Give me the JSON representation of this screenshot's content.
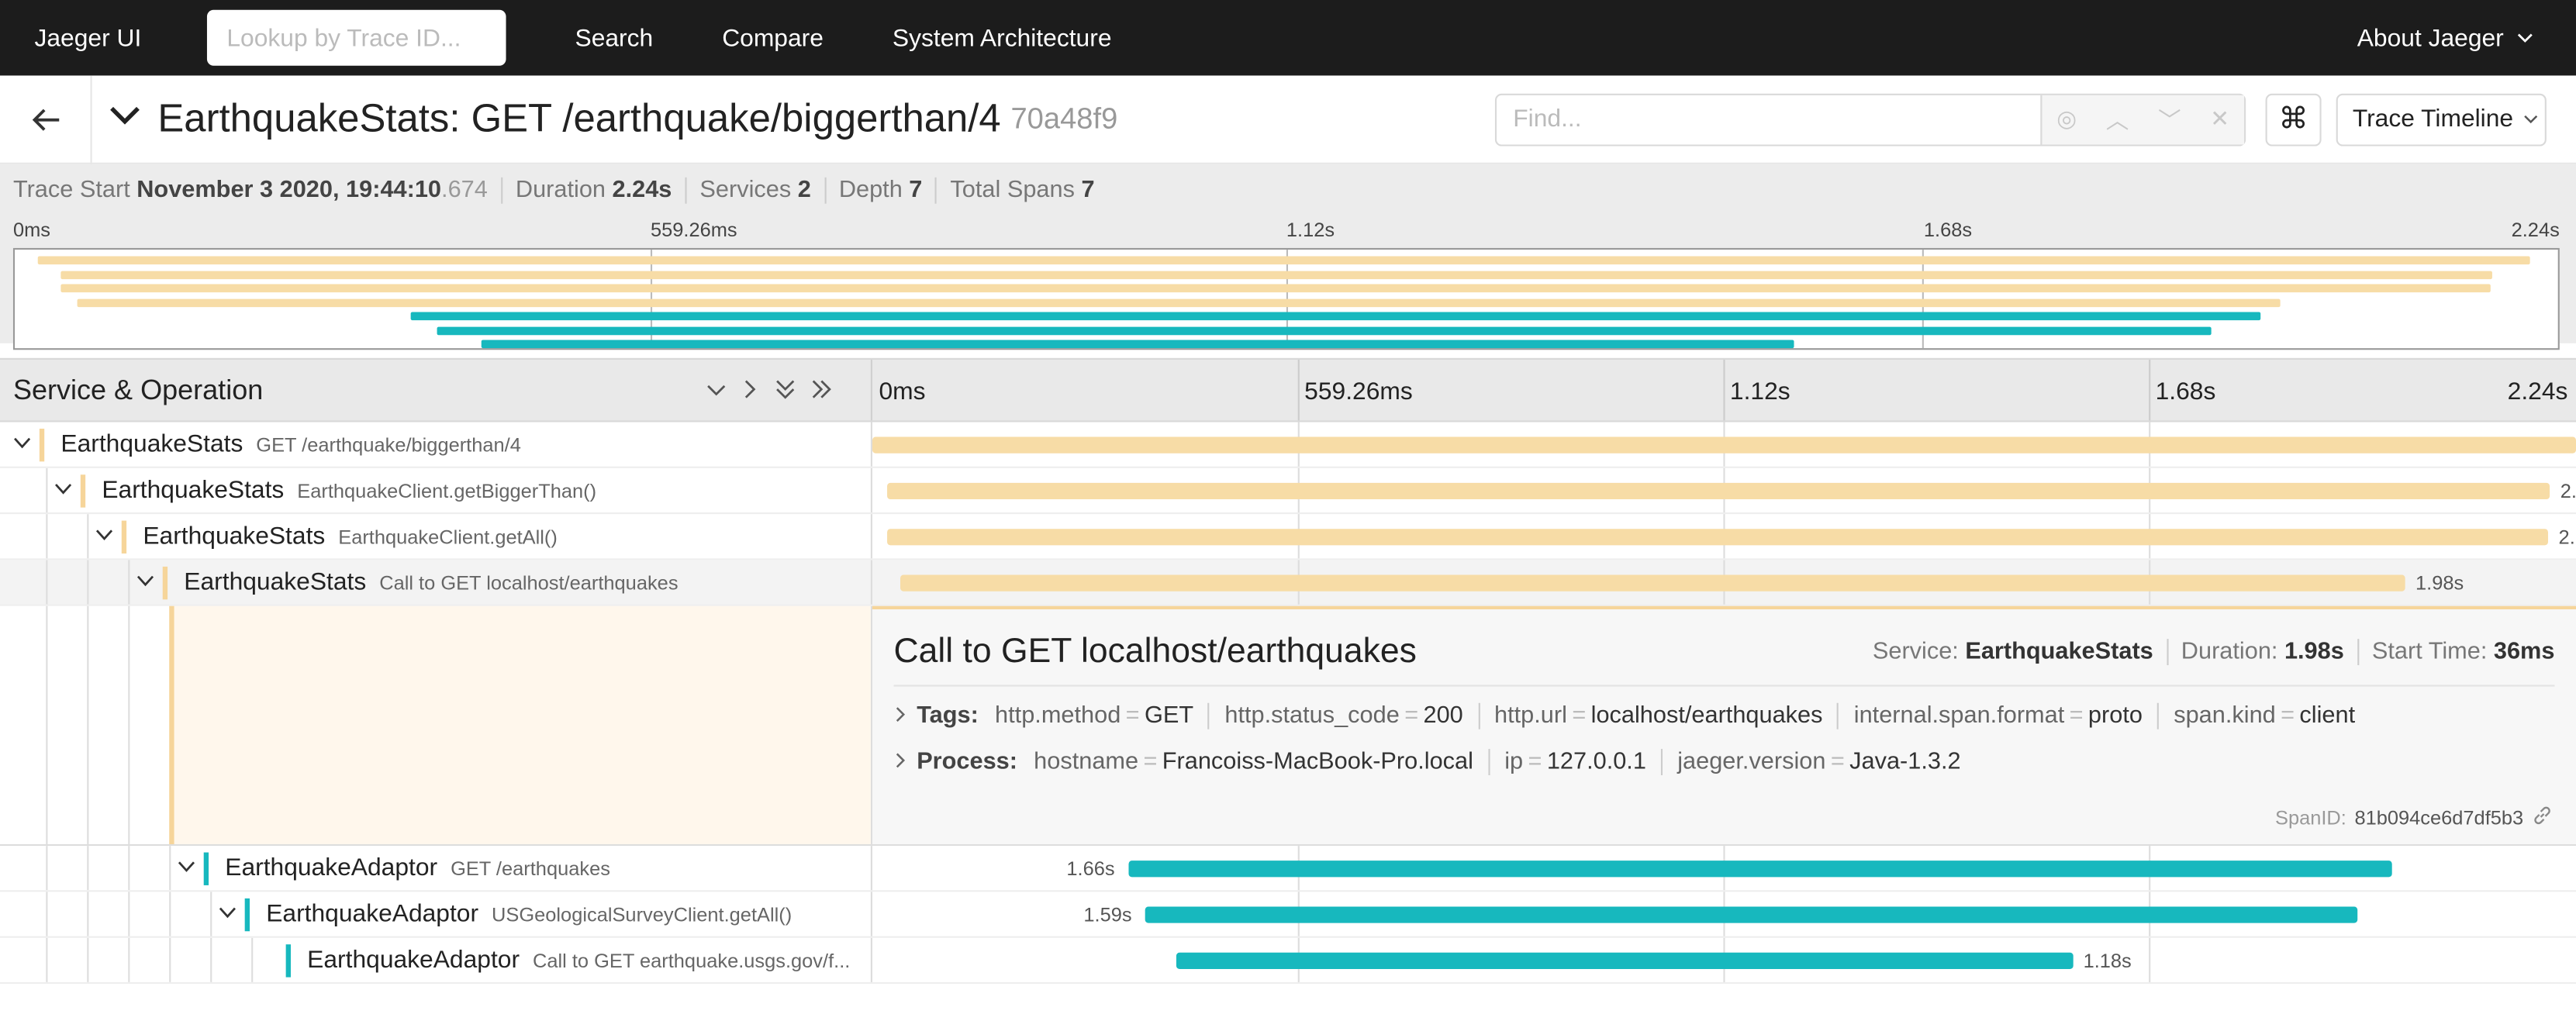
{
  "nav": {
    "brand": "Jaeger UI",
    "lookup_placeholder": "Lookup by Trace ID...",
    "links": [
      "Search",
      "Compare",
      "System Architecture"
    ],
    "about": "About Jaeger"
  },
  "trace": {
    "title": "EarthquakeStats: GET /earthquake/biggerthan/4",
    "trace_id": "70a48f9",
    "find_placeholder": "Find...",
    "view_mode": "Trace Timeline"
  },
  "summary": {
    "start_label": "Trace Start",
    "start_value": "November 3 2020, 19:44:10",
    "start_ms": ".674",
    "duration_label": "Duration",
    "duration_value": "2.24s",
    "services_label": "Services",
    "services_value": "2",
    "depth_label": "Depth",
    "depth_value": "7",
    "spans_label": "Total Spans",
    "spans_value": "7"
  },
  "ticks": [
    "0ms",
    "559.26ms",
    "1.12s",
    "1.68s",
    "2.24s"
  ],
  "colors": {
    "stats": "#f7dca6",
    "stats_mark": "#f6d59a",
    "adaptor": "#17b8be"
  },
  "header": {
    "service_operation": "Service & Operation"
  },
  "spans": [
    {
      "service": "EarthquakeStats",
      "operation": "GET /earthquake/biggerthan/4",
      "duration_label": "",
      "start_frac": 0.0,
      "end_frac": 1.0
    },
    {
      "service": "EarthquakeStats",
      "operation": "EarthquakeClient.getBiggerThan()",
      "duration_label": "2.",
      "start_frac": 0.009,
      "end_frac": 0.985
    },
    {
      "service": "EarthquakeStats",
      "operation": "EarthquakeClient.getAll()",
      "duration_label": "2.",
      "start_frac": 0.009,
      "end_frac": 0.984
    },
    {
      "service": "EarthquakeStats",
      "operation": "Call to GET localhost/earthquakes",
      "duration_label": "1.98s",
      "start_frac": 0.016,
      "end_frac": 0.9
    },
    {
      "service": "EarthquakeAdaptor",
      "operation": "GET /earthquakes",
      "duration_label": "1.66s",
      "start_frac": 0.15,
      "end_frac": 0.892
    },
    {
      "service": "EarthquakeAdaptor",
      "operation": "USGeologicalSurveyClient.getAll()",
      "duration_label": "1.59s",
      "start_frac": 0.16,
      "end_frac": 0.872
    },
    {
      "service": "EarthquakeAdaptor",
      "operation": "Call to GET earthquake.usgs.gov/f...",
      "duration_label": "1.18s",
      "start_frac": 0.178,
      "end_frac": 0.705
    }
  ],
  "detail": {
    "title": "Call to GET localhost/earthquakes",
    "service_label": "Service:",
    "service_value": "EarthquakeStats",
    "duration_label": "Duration:",
    "duration_value": "1.98s",
    "start_label": "Start Time:",
    "start_value": "36ms",
    "tags_label": "Tags:",
    "tags": [
      {
        "k": "http.method",
        "v": "GET"
      },
      {
        "k": "http.status_code",
        "v": "200"
      },
      {
        "k": "http.url",
        "v": "localhost/earthquakes"
      },
      {
        "k": "internal.span.format",
        "v": "proto"
      },
      {
        "k": "span.kind",
        "v": "client"
      }
    ],
    "process_label": "Process:",
    "process": [
      {
        "k": "hostname",
        "v": "Francoiss-MacBook-Pro.local"
      },
      {
        "k": "ip",
        "v": "127.0.0.1"
      },
      {
        "k": "jaeger.version",
        "v": "Java-1.3.2"
      }
    ],
    "spanid_label": "SpanID:",
    "spanid_value": "81b094ce6d7df5b3"
  }
}
